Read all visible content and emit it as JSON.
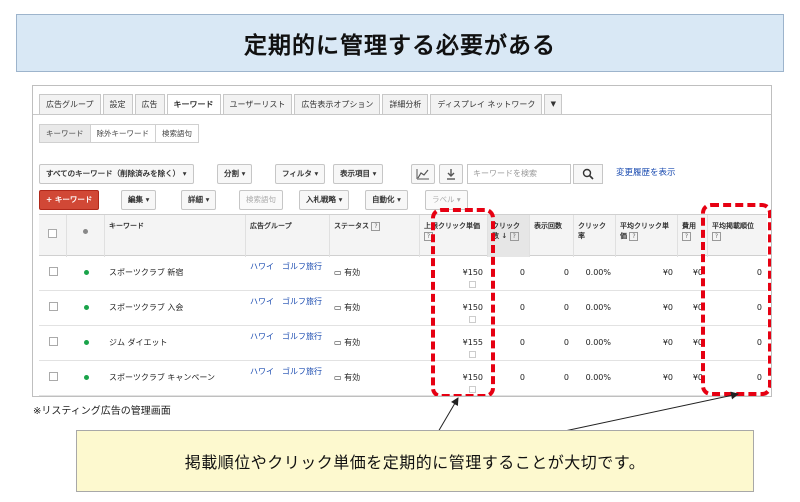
{
  "banner": {
    "title": "定期的に管理する必要がある"
  },
  "tabs": [
    {
      "label": "広告グループ"
    },
    {
      "label": "設定"
    },
    {
      "label": "広告"
    },
    {
      "label": "キーワード"
    },
    {
      "label": "ユーザーリスト"
    },
    {
      "label": "広告表示オプション"
    },
    {
      "label": "詳細分析"
    },
    {
      "label": "ディスプレイ ネットワーク"
    }
  ],
  "subtabs": [
    {
      "label": "キーワード"
    },
    {
      "label": "除外キーワード"
    },
    {
      "label": "検索語句"
    }
  ],
  "toolbar1": {
    "filter_all": "すべてのキーワード（削除済みを除く） ▾",
    "segment": "分割 ▾",
    "filter": "フィルタ ▾",
    "columns": "表示項目 ▾",
    "search_placeholder": "キーワードを検索",
    "history_link": "変更履歴を表示"
  },
  "toolbar2": {
    "add_keyword": "+ キーワード",
    "edit": "編集 ▾",
    "details": "詳細 ▾",
    "search_terms": "検索語句",
    "bid_strategy": "入札戦略 ▾",
    "automate": "自動化 ▾",
    "label": "ラベル ▾"
  },
  "table": {
    "headers": {
      "keyword": "キーワード",
      "ad_group": "広告グループ",
      "status": "ステータス",
      "max_cpc": "上限クリック単価",
      "clicks": "クリック数 ↓",
      "impressions": "表示回数",
      "ctr": "クリック率",
      "avg_cpc": "平均クリック単価",
      "cost": "費用",
      "avg_pos": "平均掲載順位"
    },
    "rows": [
      {
        "keyword": "スポーツクラブ 新宿",
        "ad_group": "ハワイ　ゴルフ旅行",
        "status": "有効",
        "max_cpc": "¥150",
        "clicks": "0",
        "impressions": "0",
        "ctr": "0.00%",
        "avg_cpc": "¥0",
        "cost": "¥0",
        "avg_pos": "0"
      },
      {
        "keyword": "スポーツクラブ 入会",
        "ad_group": "ハワイ　ゴルフ旅行",
        "status": "有効",
        "max_cpc": "¥150",
        "clicks": "0",
        "impressions": "0",
        "ctr": "0.00%",
        "avg_cpc": "¥0",
        "cost": "¥0",
        "avg_pos": "0"
      },
      {
        "keyword": "ジム ダイエット",
        "ad_group": "ハワイ　ゴルフ旅行",
        "status": "有効",
        "max_cpc": "¥155",
        "clicks": "0",
        "impressions": "0",
        "ctr": "0.00%",
        "avg_cpc": "¥0",
        "cost": "¥0",
        "avg_pos": "0"
      },
      {
        "keyword": "スポーツクラブ キャンペーン",
        "ad_group": "ハワイ　ゴルフ旅行",
        "status": "有効",
        "max_cpc": "¥150",
        "clicks": "0",
        "impressions": "0",
        "ctr": "0.00%",
        "avg_cpc": "¥0",
        "cost": "¥0",
        "avg_pos": "0"
      }
    ]
  },
  "caption": "※リスティング広告の管理画面",
  "callout": "掲載順位やクリック単価を定期的に管理することが大切です。",
  "colors": {
    "highlight": "#e60012",
    "banner_bg": "#d9e8f5",
    "callout_bg": "#fdf9cf",
    "link": "#1a4bb0",
    "add_button": "#d14836"
  }
}
